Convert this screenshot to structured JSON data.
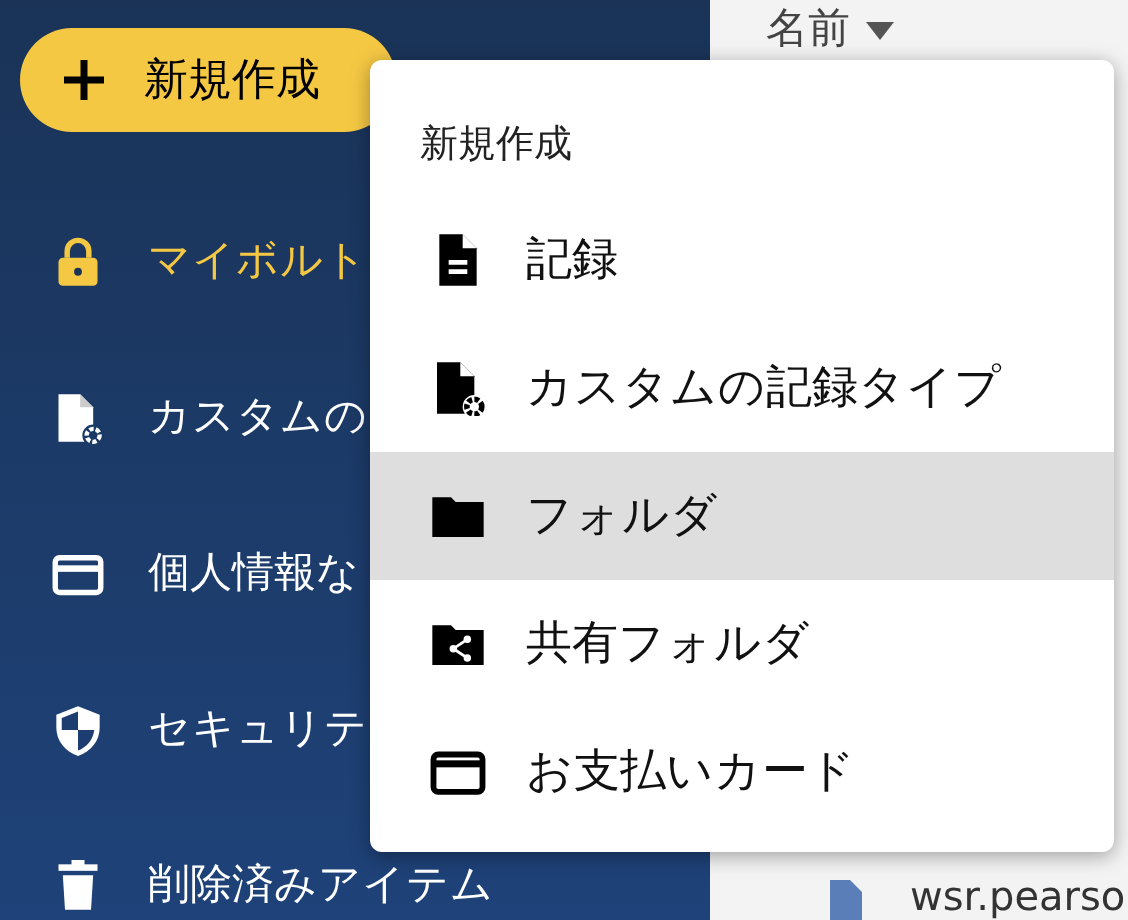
{
  "new_button": {
    "label": "新規作成"
  },
  "sidebar": {
    "items": [
      {
        "kind": "lock",
        "label": "マイボルト",
        "selected": true
      },
      {
        "kind": "custom",
        "label": "カスタムの",
        "selected": false
      },
      {
        "kind": "card",
        "label": "個人情報な",
        "selected": false
      },
      {
        "kind": "shield",
        "label": "セキュリテ",
        "selected": false
      },
      {
        "kind": "trash",
        "label": "削除済みアイテム",
        "selected": false
      }
    ]
  },
  "list": {
    "header": "名前",
    "files": [
      {
        "name": "wsr.pearso"
      }
    ]
  },
  "menu": {
    "title": "新規作成",
    "items": [
      {
        "kind": "record",
        "label": "記録",
        "selected": false
      },
      {
        "kind": "custom",
        "label": "カスタムの記録タイプ",
        "selected": false
      },
      {
        "kind": "folder",
        "label": "フォルダ",
        "selected": true
      },
      {
        "kind": "shared",
        "label": "共有フォルダ",
        "selected": false
      },
      {
        "kind": "card",
        "label": "お支払いカード",
        "selected": false
      }
    ]
  }
}
